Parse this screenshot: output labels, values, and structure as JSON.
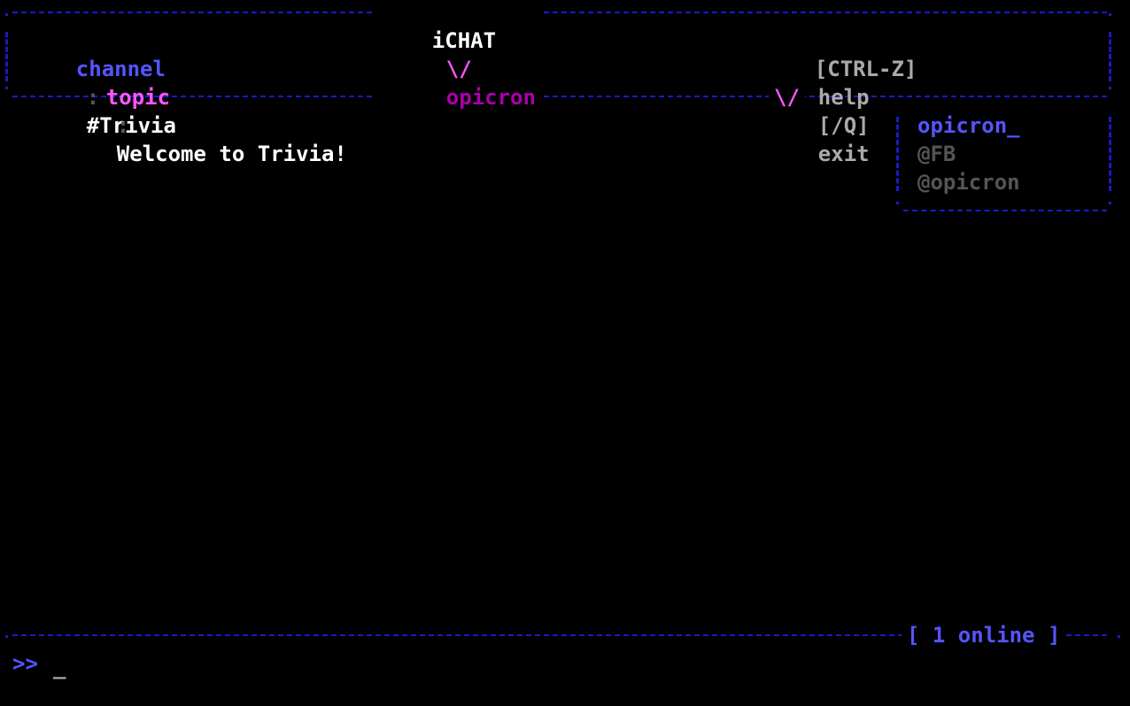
{
  "header": {
    "app_name": "iCHAT",
    "separator_glyph": "\\/",
    "nickname": "opicron",
    "channel_label": "channel",
    "channel_value": "#Trivia",
    "topic_label": "topic",
    "topic_value": "Welcome to Trivia!",
    "field_colon": ":",
    "help_hint": {
      "key1": "[CTRL-Z]",
      "action1": "help",
      "key2": "[/Q]",
      "action2": "exit"
    },
    "divider_glyph": "\\/"
  },
  "users_panel": {
    "title": "opicron_",
    "users": [
      "@FB",
      "@opicron"
    ]
  },
  "status": {
    "online_text": "[ 1 online ]"
  },
  "input": {
    "prompt": ">>",
    "cursor": "_"
  },
  "colors": {
    "border": "#1a1ac8",
    "accent_blue": "#5555ff",
    "accent_magenta": "#aa00aa",
    "topic_pink": "#ff55ff",
    "text": "#ffffff",
    "muted": "#aaaaaa",
    "user_gray": "#555555"
  }
}
